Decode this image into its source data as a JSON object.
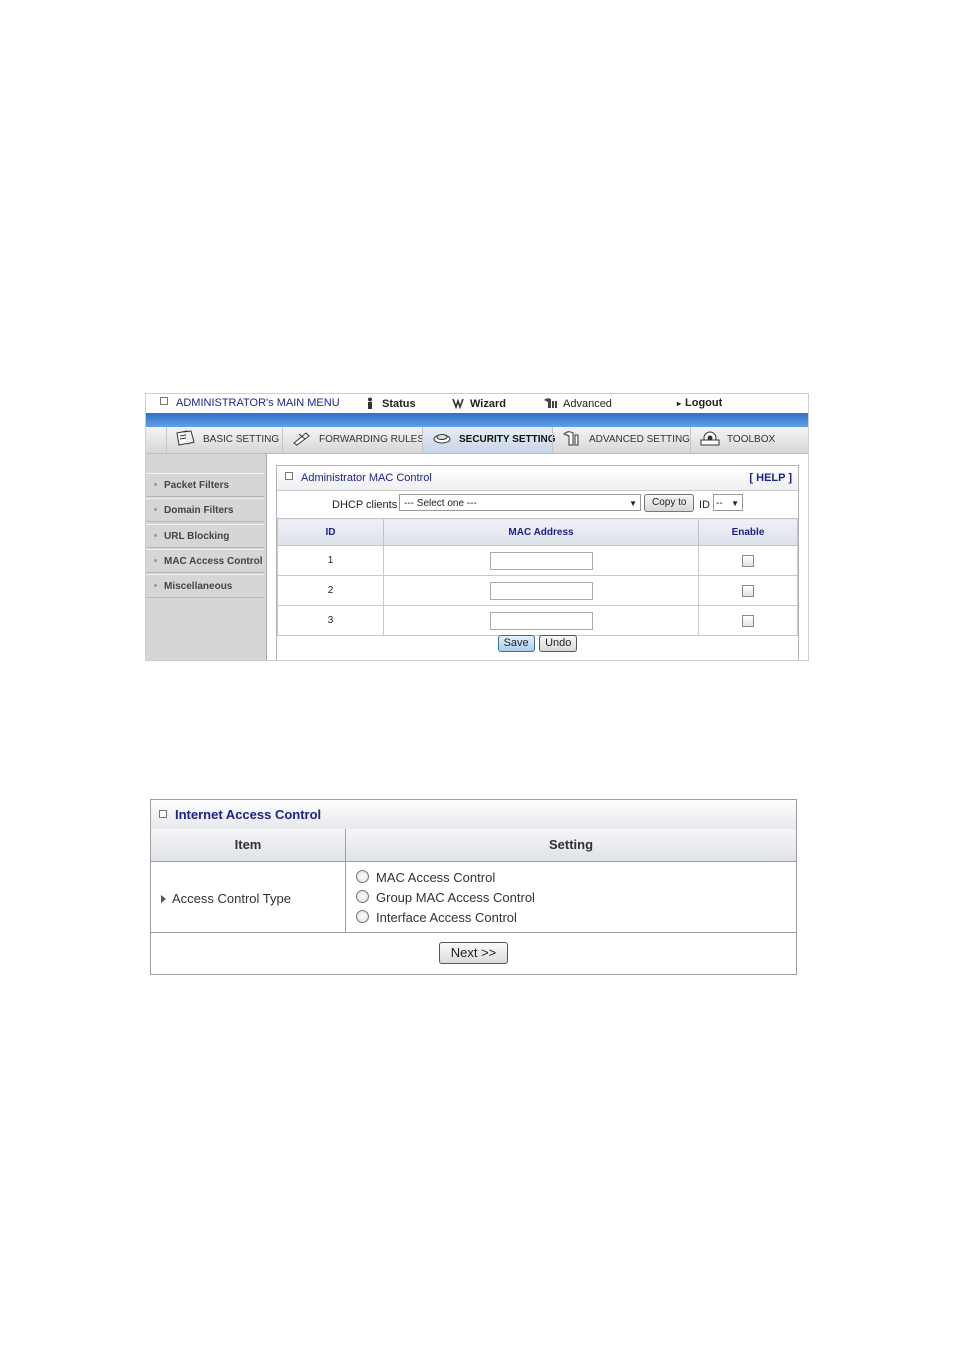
{
  "top_menu": {
    "title": "ADMINISTRATOR's MAIN MENU",
    "status": "Status",
    "wizard": "Wizard",
    "advanced": "Advanced",
    "logout": "Logout"
  },
  "tabs": [
    {
      "label": "BASIC SETTING",
      "icon": "notebook-icon"
    },
    {
      "label": "FORWARDING RULES",
      "icon": "pen-icon"
    },
    {
      "label": "SECURITY SETTING",
      "icon": "lock-icon",
      "active": true
    },
    {
      "label": "ADVANCED SETTING",
      "icon": "tools-icon"
    },
    {
      "label": "TOOLBOX",
      "icon": "toolbox-icon"
    }
  ],
  "sidebar": {
    "items": [
      {
        "label": "Packet Filters"
      },
      {
        "label": "Domain Filters"
      },
      {
        "label": "URL Blocking"
      },
      {
        "label": "MAC Access Control"
      },
      {
        "label": "Miscellaneous"
      }
    ]
  },
  "mac_panel": {
    "title": "Administrator MAC Control",
    "help": "[ HELP ]",
    "dhcp_label": "DHCP clients",
    "dhcp_select": "--- Select one ---",
    "copy_button": "Copy to",
    "id_label": "ID",
    "id_select": "--",
    "columns": [
      "ID",
      "MAC Address",
      "Enable"
    ],
    "rows": [
      {
        "id": "1",
        "mac": "",
        "enabled": false
      },
      {
        "id": "2",
        "mac": "",
        "enabled": false
      },
      {
        "id": "3",
        "mac": "",
        "enabled": false
      }
    ],
    "save_button": "Save",
    "undo_button": "Undo"
  },
  "iac_panel": {
    "title": "Internet Access Control",
    "col_item": "Item",
    "col_setting": "Setting",
    "row_label": "Access Control Type",
    "options": [
      "MAC Access Control",
      "Group MAC Access Control",
      "Interface Access Control"
    ],
    "next_button": "Next >>"
  },
  "colors": {
    "accent_blue": "#2c6fc8",
    "title_navy": "#1f1f8c"
  }
}
